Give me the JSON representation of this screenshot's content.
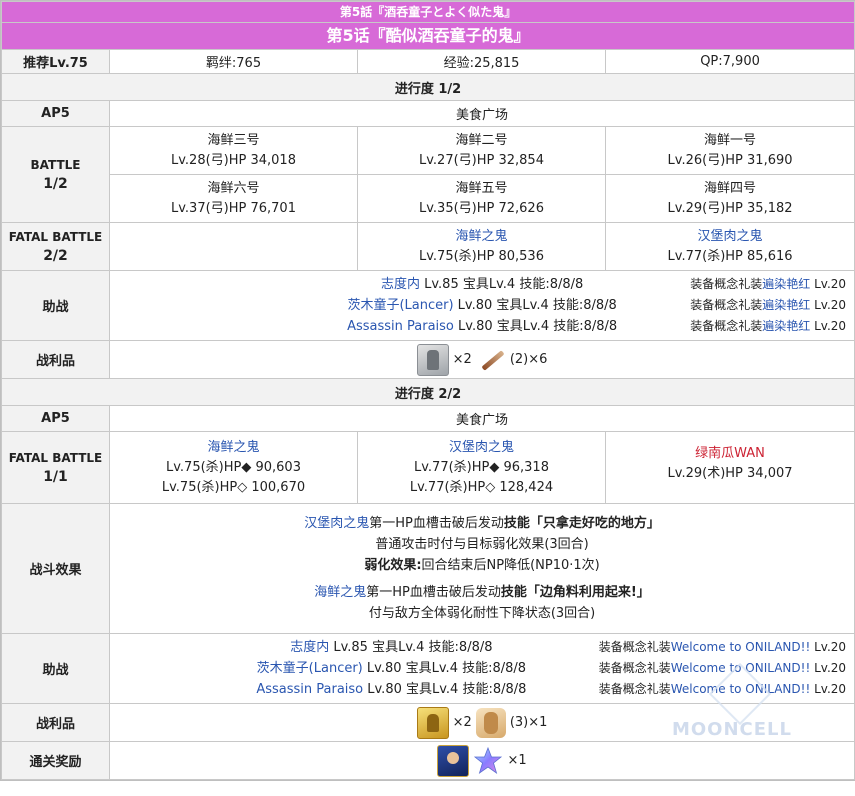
{
  "header": {
    "jp_title": "第5話『酒呑童子とよく似た鬼』",
    "cn_title": "第5话『酷似酒吞童子的鬼』"
  },
  "summary": {
    "recommend": "推荐Lv.75",
    "bond": "羁绊:765",
    "exp": "经验:25,815",
    "qp": "QP:7,900"
  },
  "part1": {
    "progress": "进行度 1/2",
    "ap": "AP5",
    "location": "美食广场",
    "battle_label_1": "BATTLE",
    "battle_label_2": "1/2",
    "battle_row1": [
      {
        "name": "海鲜三号",
        "stat": "Lv.28(弓)HP 34,018"
      },
      {
        "name": "海鲜二号",
        "stat": "Lv.27(弓)HP 32,854"
      },
      {
        "name": "海鲜一号",
        "stat": "Lv.26(弓)HP 31,690"
      }
    ],
    "battle_row2": [
      {
        "name": "海鲜六号",
        "stat": "Lv.37(弓)HP 76,701"
      },
      {
        "name": "海鲜五号",
        "stat": "Lv.35(弓)HP 72,626"
      },
      {
        "name": "海鲜四号",
        "stat": "Lv.29(弓)HP 35,182"
      }
    ],
    "fatal_label_1": "FATAL BATTLE",
    "fatal_label_2": "2/2",
    "fatal": [
      {
        "name": "海鲜之鬼",
        "stat": "Lv.75(杀)HP 80,536"
      },
      {
        "name": "汉堡肉之鬼",
        "stat": "Lv.77(杀)HP 85,616"
      }
    ],
    "support_label": "助战",
    "supports": [
      {
        "servant": "志度内",
        "rest": " Lv.85 宝具Lv.4 技能:8/8/8",
        "ce_prefix": "装备概念礼装",
        "ce": "遍染艳红",
        "ce_lv": " Lv.20"
      },
      {
        "servant": "茨木童子(Lancer)",
        "rest": " Lv.80 宝具Lv.4 技能:8/8/8",
        "ce_prefix": "装备概念礼装",
        "ce": "遍染艳红",
        "ce_lv": " Lv.20"
      },
      {
        "servant": "Assassin Paraiso",
        "rest": " Lv.80 宝具Lv.4 技能:8/8/8",
        "ce_prefix": "装备概念礼装",
        "ce": "遍染艳红",
        "ce_lv": " Lv.20"
      }
    ],
    "loot_label": "战利品",
    "loot": [
      {
        "icon": "silver-statue-icon",
        "qty": "×2"
      },
      {
        "icon": "knife-icon",
        "qty": "(2)×6"
      }
    ]
  },
  "part2": {
    "progress": "进行度 2/2",
    "ap": "AP5",
    "location": "美食广场",
    "fatal_label_1": "FATAL BATTLE",
    "fatal_label_2": "1/1",
    "enemies": [
      {
        "name": "海鲜之鬼",
        "stat1": "Lv.75(杀)HP◆ 90,603",
        "stat2": "Lv.75(杀)HP◇ 100,670"
      },
      {
        "name": "汉堡肉之鬼",
        "stat1": "Lv.77(杀)HP◆ 96,318",
        "stat2": "Lv.77(杀)HP◇ 128,424"
      },
      {
        "name": "绿南瓜WAN",
        "stat1": "Lv.29(术)HP 34,007",
        "stat2": ""
      }
    ],
    "effect_label": "战斗效果",
    "effect": {
      "l1_link": "汉堡肉之鬼",
      "l1_mid": "第一HP血槽击破后发动",
      "l1_skill": "技能「只拿走好吃的地方」",
      "l2": "普通攻击时付与目标弱化效果(3回合)",
      "l3_bold": "弱化效果:",
      "l3_rest": "回合结束后NP降低(NP10·1次)",
      "l4_link": "海鲜之鬼",
      "l4_mid": "第一HP血槽击破后发动",
      "l4_skill": "技能「边角料利用起来!」",
      "l5": "付与敌方全体弱化耐性下降状态(3回合)"
    },
    "support_label": "助战",
    "supports": [
      {
        "servant": "志度内",
        "rest": " Lv.85 宝具Lv.4 技能:8/8/8",
        "ce_prefix": "装备概念礼装",
        "ce": "Welcome to ONILAND!!",
        "ce_lv": " Lv.20"
      },
      {
        "servant": "茨木童子(Lancer)",
        "rest": " Lv.80 宝具Lv.4 技能:8/8/8",
        "ce_prefix": "装备概念礼装",
        "ce": "Welcome to ONILAND!!",
        "ce_lv": " Lv.20"
      },
      {
        "servant": "Assassin Paraiso",
        "rest": " Lv.80 宝具Lv.4 技能:8/8/8",
        "ce_prefix": "装备概念礼装",
        "ce": "Welcome to ONILAND!!",
        "ce_lv": " Lv.20"
      }
    ],
    "loot_label": "战利品",
    "loot": [
      {
        "icon": "gold-statue-icon",
        "qty": "×2"
      },
      {
        "icon": "bun-icon",
        "qty": "(3)×1"
      }
    ],
    "reward_label": "通关奖励",
    "reward_qty": "×1"
  },
  "watermark": "MOONCELL",
  "colors": {
    "header": "#d76ad7",
    "link": "#2a56b0",
    "red_enemy": "#cc2233",
    "label_bg": "#f2f2f2"
  }
}
